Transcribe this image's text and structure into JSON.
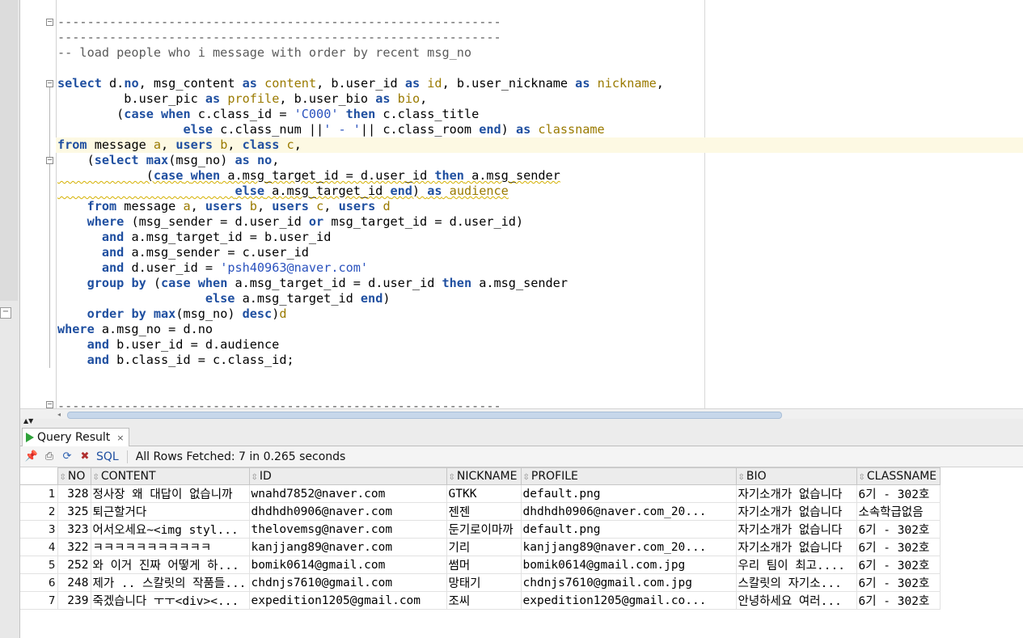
{
  "editor": {
    "lines": [
      {
        "segs": [
          {
            "c": "cmt",
            "t": "------------------------------------------------------------"
          }
        ],
        "fold": "-"
      },
      {
        "segs": [
          {
            "c": "cmt",
            "t": "------------------------------------------------------------"
          }
        ]
      },
      {
        "segs": [
          {
            "c": "cmt",
            "t": "-- load people who i message with order by recent msg_no"
          }
        ]
      },
      {
        "segs": [
          {
            "c": "",
            "t": ""
          }
        ]
      },
      {
        "segs": [
          {
            "c": "kw",
            "t": "select"
          },
          {
            "c": "",
            "t": " d."
          },
          {
            "c": "kw",
            "t": "no"
          },
          {
            "c": "",
            "t": ", msg_content "
          },
          {
            "c": "kw",
            "t": "as"
          },
          {
            "c": "",
            "t": " "
          },
          {
            "c": "id",
            "t": "content"
          },
          {
            "c": "",
            "t": ", b.user_id "
          },
          {
            "c": "kw",
            "t": "as"
          },
          {
            "c": "",
            "t": " "
          },
          {
            "c": "id",
            "t": "id"
          },
          {
            "c": "",
            "t": ", b.user_nickname "
          },
          {
            "c": "kw",
            "t": "as"
          },
          {
            "c": "",
            "t": " "
          },
          {
            "c": "id",
            "t": "nickname"
          },
          {
            "c": "",
            "t": ","
          }
        ],
        "fold": "-"
      },
      {
        "segs": [
          {
            "c": "",
            "t": "         b.user_pic "
          },
          {
            "c": "kw",
            "t": "as"
          },
          {
            "c": "",
            "t": " "
          },
          {
            "c": "id",
            "t": "profile"
          },
          {
            "c": "",
            "t": ", b.user_bio "
          },
          {
            "c": "kw",
            "t": "as"
          },
          {
            "c": "",
            "t": " "
          },
          {
            "c": "id",
            "t": "bio"
          },
          {
            "c": "",
            "t": ","
          }
        ]
      },
      {
        "segs": [
          {
            "c": "",
            "t": "        ("
          },
          {
            "c": "kw",
            "t": "case"
          },
          {
            "c": "",
            "t": " "
          },
          {
            "c": "kw",
            "t": "when"
          },
          {
            "c": "",
            "t": " c.class_id = "
          },
          {
            "c": "str",
            "t": "'C000'"
          },
          {
            "c": "",
            "t": " "
          },
          {
            "c": "kw",
            "t": "then"
          },
          {
            "c": "",
            "t": " c.class_title"
          }
        ]
      },
      {
        "segs": [
          {
            "c": "",
            "t": "                 "
          },
          {
            "c": "kw",
            "t": "else"
          },
          {
            "c": "",
            "t": " c.class_num ||"
          },
          {
            "c": "str",
            "t": "' - '"
          },
          {
            "c": "",
            "t": "|| c.class_room "
          },
          {
            "c": "kw",
            "t": "end"
          },
          {
            "c": "",
            "t": ") "
          },
          {
            "c": "kw",
            "t": "as"
          },
          {
            "c": "",
            "t": " "
          },
          {
            "c": "id",
            "t": "classname"
          }
        ]
      },
      {
        "segs": [
          {
            "c": "kw",
            "t": "from"
          },
          {
            "c": "",
            "t": " message "
          },
          {
            "c": "id",
            "t": "a"
          },
          {
            "c": "",
            "t": ", "
          },
          {
            "c": "kw",
            "t": "users"
          },
          {
            "c": "",
            "t": " "
          },
          {
            "c": "id",
            "t": "b"
          },
          {
            "c": "",
            "t": ", "
          },
          {
            "c": "kw",
            "t": "class"
          },
          {
            "c": "",
            "t": " "
          },
          {
            "c": "id",
            "t": "c"
          },
          {
            "c": "",
            "t": ","
          }
        ],
        "highlight": true
      },
      {
        "segs": [
          {
            "c": "",
            "t": "    ("
          },
          {
            "c": "kw",
            "t": "select"
          },
          {
            "c": "",
            "t": " "
          },
          {
            "c": "kw",
            "t": "max"
          },
          {
            "c": "",
            "t": "(msg_no) "
          },
          {
            "c": "kw",
            "t": "as"
          },
          {
            "c": "",
            "t": " "
          },
          {
            "c": "kw",
            "t": "no"
          },
          {
            "c": "",
            "t": ","
          }
        ],
        "fold": "-"
      },
      {
        "segs": [
          {
            "c": "",
            "t": "            ("
          },
          {
            "c": "kw",
            "t": "case"
          },
          {
            "c": "",
            "t": " "
          },
          {
            "c": "kw",
            "t": "when"
          },
          {
            "c": "",
            "t": " a.msg_target_id = d.user_id "
          },
          {
            "c": "kw",
            "t": "then"
          },
          {
            "c": "",
            "t": " a.msg_sender"
          }
        ],
        "squiggle": true
      },
      {
        "segs": [
          {
            "c": "",
            "t": "                        "
          },
          {
            "c": "kw",
            "t": "else"
          },
          {
            "c": "",
            "t": " a.msg_target_id "
          },
          {
            "c": "kw",
            "t": "end"
          },
          {
            "c": "",
            "t": ") "
          },
          {
            "c": "kw",
            "t": "as"
          },
          {
            "c": "",
            "t": " "
          },
          {
            "c": "id",
            "t": "audience"
          }
        ],
        "squiggle": true
      },
      {
        "segs": [
          {
            "c": "",
            "t": "    "
          },
          {
            "c": "kw",
            "t": "from"
          },
          {
            "c": "",
            "t": " message "
          },
          {
            "c": "id",
            "t": "a"
          },
          {
            "c": "",
            "t": ", "
          },
          {
            "c": "kw",
            "t": "users"
          },
          {
            "c": "",
            "t": " "
          },
          {
            "c": "id",
            "t": "b"
          },
          {
            "c": "",
            "t": ", "
          },
          {
            "c": "kw",
            "t": "users"
          },
          {
            "c": "",
            "t": " "
          },
          {
            "c": "id",
            "t": "c"
          },
          {
            "c": "",
            "t": ", "
          },
          {
            "c": "kw",
            "t": "users"
          },
          {
            "c": "",
            "t": " "
          },
          {
            "c": "id",
            "t": "d"
          }
        ]
      },
      {
        "segs": [
          {
            "c": "",
            "t": "    "
          },
          {
            "c": "kw",
            "t": "where"
          },
          {
            "c": "",
            "t": " (msg_sender = d.user_id "
          },
          {
            "c": "kw",
            "t": "or"
          },
          {
            "c": "",
            "t": " msg_target_id = d.user_id)"
          }
        ]
      },
      {
        "segs": [
          {
            "c": "",
            "t": "      "
          },
          {
            "c": "kw",
            "t": "and"
          },
          {
            "c": "",
            "t": " a.msg_target_id = b.user_id"
          }
        ]
      },
      {
        "segs": [
          {
            "c": "",
            "t": "      "
          },
          {
            "c": "kw",
            "t": "and"
          },
          {
            "c": "",
            "t": " a.msg_sender = c.user_id"
          }
        ]
      },
      {
        "segs": [
          {
            "c": "",
            "t": "      "
          },
          {
            "c": "kw",
            "t": "and"
          },
          {
            "c": "",
            "t": " d.user_id = "
          },
          {
            "c": "str",
            "t": "'psh40963@naver.com'"
          }
        ]
      },
      {
        "segs": [
          {
            "c": "",
            "t": "    "
          },
          {
            "c": "kw",
            "t": "group by"
          },
          {
            "c": "",
            "t": " ("
          },
          {
            "c": "kw",
            "t": "case"
          },
          {
            "c": "",
            "t": " "
          },
          {
            "c": "kw",
            "t": "when"
          },
          {
            "c": "",
            "t": " a.msg_target_id = d.user_id "
          },
          {
            "c": "kw",
            "t": "then"
          },
          {
            "c": "",
            "t": " a.msg_sender"
          }
        ]
      },
      {
        "segs": [
          {
            "c": "",
            "t": "                    "
          },
          {
            "c": "kw",
            "t": "else"
          },
          {
            "c": "",
            "t": " a.msg_target_id "
          },
          {
            "c": "kw",
            "t": "end"
          },
          {
            "c": "",
            "t": ")"
          }
        ]
      },
      {
        "segs": [
          {
            "c": "",
            "t": "    "
          },
          {
            "c": "kw",
            "t": "order by"
          },
          {
            "c": "",
            "t": " "
          },
          {
            "c": "kw",
            "t": "max"
          },
          {
            "c": "",
            "t": "(msg_no) "
          },
          {
            "c": "kw",
            "t": "desc"
          },
          {
            "c": "",
            "t": ")"
          },
          {
            "c": "id",
            "t": "d"
          }
        ]
      },
      {
        "segs": [
          {
            "c": "kw",
            "t": "where"
          },
          {
            "c": "",
            "t": " a.msg_no = d.no"
          }
        ]
      },
      {
        "segs": [
          {
            "c": "",
            "t": "    "
          },
          {
            "c": "kw",
            "t": "and"
          },
          {
            "c": "",
            "t": " b.user_id = d.audience"
          }
        ]
      },
      {
        "segs": [
          {
            "c": "",
            "t": "    "
          },
          {
            "c": "kw",
            "t": "and"
          },
          {
            "c": "",
            "t": " b.class_id = c.class_id;"
          }
        ]
      },
      {
        "segs": [
          {
            "c": "",
            "t": ""
          }
        ]
      },
      {
        "segs": [
          {
            "c": "",
            "t": ""
          }
        ]
      },
      {
        "segs": [
          {
            "c": "cmt",
            "t": "------------------------------------------------------------"
          }
        ],
        "fold": "-"
      }
    ]
  },
  "result_tab": {
    "label": "Query Result",
    "close": "×"
  },
  "toolbar": {
    "sql_label": "SQL",
    "status": "All Rows Fetched: 7 in 0.265 seconds"
  },
  "grid": {
    "columns": [
      "NO",
      "CONTENT",
      "ID",
      "NICKNAME",
      "PROFILE",
      "BIO",
      "CLASSNAME"
    ],
    "rows": [
      {
        "rn": "1",
        "cells": [
          "328",
          "정사장 왜 대답이 없습니까",
          "wnahd7852@naver.com",
          "GTKK",
          "default.png",
          "자기소개가 없습니다",
          "6기 - 302호"
        ]
      },
      {
        "rn": "2",
        "cells": [
          "325",
          "퇴근할거다",
          "dhdhdh0906@naver.com",
          "젠젠",
          "dhdhdh0906@naver.com_20...",
          "자기소개가 없습니다",
          "소속학급없음"
        ]
      },
      {
        "rn": "3",
        "cells": [
          "323",
          "어서오세요~<img styl...",
          "thelovemsg@naver.com",
          "둔기로이마까",
          "default.png",
          "자기소개가 없습니다",
          "6기 - 302호"
        ]
      },
      {
        "rn": "4",
        "cells": [
          "322",
          "ㅋㅋㅋㅋㅋㅋㅋㅋㅋㅋㅋ",
          "kanjjang89@naver.com",
          "기리",
          "kanjjang89@naver.com_20...",
          "자기소개가 없습니다",
          "6기 - 302호"
        ]
      },
      {
        "rn": "5",
        "cells": [
          "252",
          "와 이거 진짜 어떻게 하...",
          "bomik0614@gmail.com",
          "썸머",
          "bomik0614@gmail.com.jpg",
          "우리 팀이 최고....",
          "6기 - 302호"
        ]
      },
      {
        "rn": "6",
        "cells": [
          "248",
          "제가 .. 스칼릿의 작품들...",
          "chdnjs7610@gmail.com",
          "망태기",
          "chdnjs7610@gmail.com.jpg",
          "스칼릿의 자기소...",
          "6기 - 302호"
        ]
      },
      {
        "rn": "7",
        "cells": [
          "239",
          "죽겠습니다 ㅜㅜ<div><...",
          "expedition1205@gmail.com",
          "조씨",
          "expedition1205@gmail.co...",
          "안녕하세요 여러...",
          "6기 - 302호"
        ]
      }
    ]
  },
  "colors": {
    "keyword": "#1f4fa0",
    "string": "#2a52be",
    "identifier": "#9a7a00",
    "comment": "#5a5a5a",
    "run_icon": "#2fa23a"
  }
}
